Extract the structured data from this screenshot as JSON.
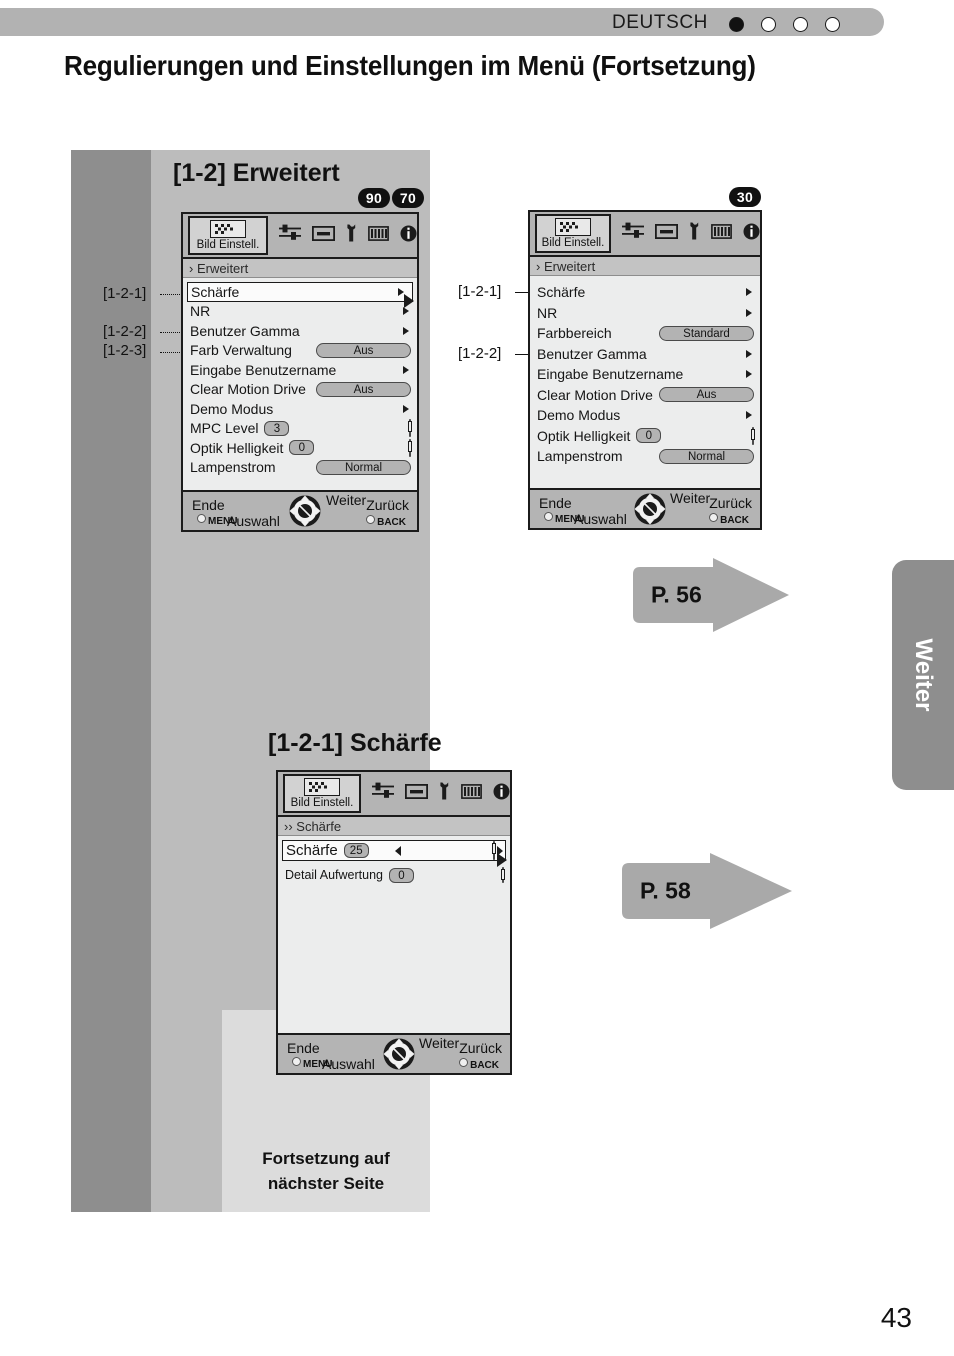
{
  "header": {
    "language": "DEUTSCH",
    "dots": [
      "filled",
      "hollow",
      "hollow",
      "hollow"
    ]
  },
  "page_title": "Regulierungen und Einstellungen im Menü (Fortsetzung)",
  "page_number": "43",
  "side_tab": {
    "label": "Weiter"
  },
  "continuation_note": {
    "line1": "Fortsetzung auf",
    "line2": "nächster Seite"
  },
  "sections": {
    "section1": {
      "title": "[1-2] Erweitert",
      "badges": [
        "90",
        "70"
      ],
      "callouts": [
        "[1-2-1]",
        "[1-2-2]",
        "[1-2-3]"
      ]
    },
    "section2": {
      "title": "[1-2-1] Schärfe"
    }
  },
  "menu_common": {
    "tab_label": "Bild Einstell.",
    "icons": [
      "picture-icon",
      "sliders-icon",
      "screen-icon",
      "wrench-icon",
      "grid-icon",
      "info-icon"
    ],
    "footer": {
      "ende": "Ende",
      "menu": "MENU",
      "auswahl": "Auswahl",
      "weiter": "Weiter",
      "zurueck": "Zurück",
      "back": "BACK"
    }
  },
  "menu_left": {
    "breadcrumb": "› Erweitert",
    "badges": [
      "90",
      "70"
    ],
    "items": [
      {
        "label": "Schärfe",
        "type": "submenu",
        "selected": true
      },
      {
        "label": "NR",
        "type": "submenu"
      },
      {
        "label": "Benutzer Gamma",
        "type": "submenu"
      },
      {
        "label": "Farb Verwaltung",
        "type": "value",
        "value": "Aus"
      },
      {
        "label": "Eingabe Benutzername",
        "type": "submenu"
      },
      {
        "label": "Clear Motion Drive",
        "type": "value",
        "value": "Aus"
      },
      {
        "label": "Demo Modus",
        "type": "submenu"
      },
      {
        "label": "MPC Level",
        "type": "slider",
        "value": "3",
        "thumb_pct": 88
      },
      {
        "label": "Optik Helligkeit",
        "type": "slider",
        "value": "0",
        "thumb_pct": 92
      },
      {
        "label": "Lampenstrom",
        "type": "value",
        "value": "Normal"
      }
    ]
  },
  "menu_right": {
    "breadcrumb": "› Erweitert",
    "badges": [
      "30"
    ],
    "callouts": [
      "[1-2-1]",
      "[1-2-2]"
    ],
    "items": [
      {
        "label": "Schärfe",
        "type": "submenu"
      },
      {
        "label": "NR",
        "type": "submenu"
      },
      {
        "label": "Farbbereich",
        "type": "value",
        "value": "Standard"
      },
      {
        "label": "Benutzer Gamma",
        "type": "submenu"
      },
      {
        "label": "Eingabe Benutzername",
        "type": "submenu"
      },
      {
        "label": "Clear Motion Drive",
        "type": "value",
        "value": "Aus"
      },
      {
        "label": "Demo Modus",
        "type": "submenu"
      },
      {
        "label": "Optik Helligkeit",
        "type": "slider",
        "value": "0",
        "thumb_pct": 92
      },
      {
        "label": "Lampenstrom",
        "type": "value",
        "value": "Normal"
      }
    ]
  },
  "menu_sharpness": {
    "breadcrumb": "›› Schärfe",
    "items": [
      {
        "label": "Schärfe",
        "type": "slider",
        "value": "25",
        "thumb_pct": 48,
        "selected": true,
        "carets": true
      },
      {
        "label": "Detail Aufwertung",
        "type": "slider",
        "value": "0",
        "thumb_pct": 4
      }
    ]
  },
  "page_arrows": [
    {
      "label": "P. 56"
    },
    {
      "label": "P. 58"
    }
  ]
}
